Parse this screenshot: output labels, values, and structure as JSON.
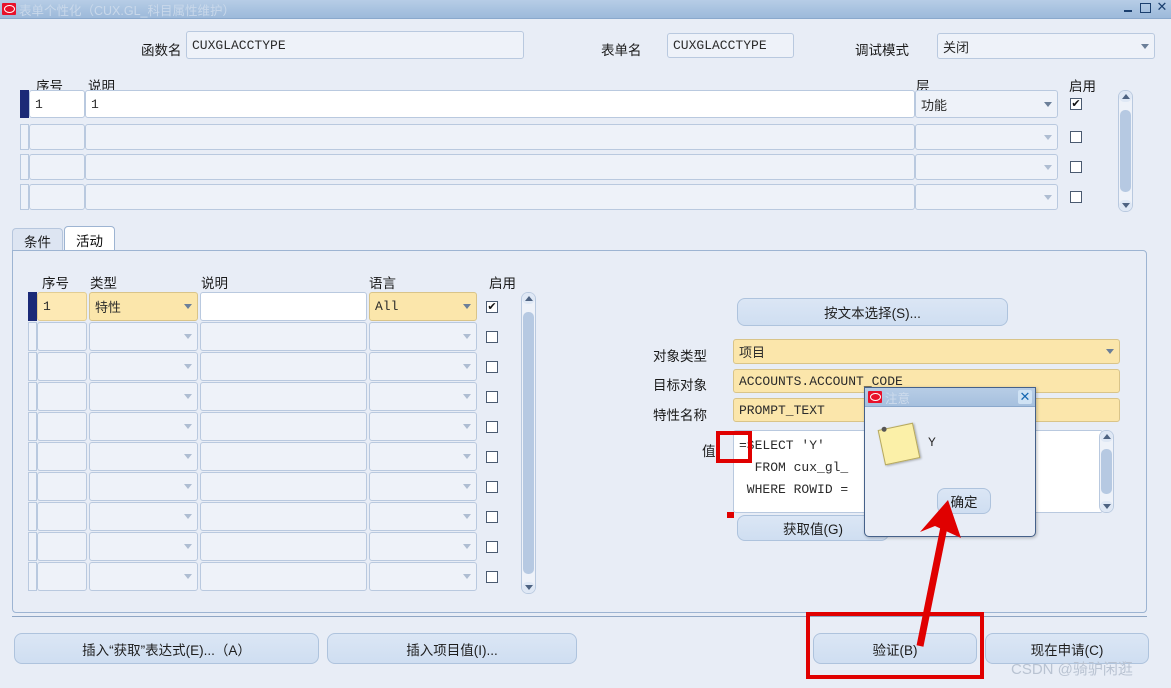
{
  "window": {
    "title": "表单个性化（CUX.GL_科目属性维护）",
    "icon": "oracle-logo-icon",
    "buttons": {
      "minimize": "–",
      "maximize": "□",
      "close": "✕"
    }
  },
  "header": {
    "function_name_label": "函数名",
    "function_name_value": "CUXGLACCTYPE",
    "form_name_label": "表单名",
    "form_name_value": "CUXGLACCTYPE",
    "debug_mode_label": "调试模式",
    "debug_mode_value": "关闭"
  },
  "rules_table": {
    "columns": [
      "序号",
      "说明",
      "层",
      "启用"
    ],
    "rows": [
      {
        "seq": "1",
        "desc": "1",
        "level": "功能",
        "enabled": true,
        "selected": true
      },
      {
        "seq": "",
        "desc": "",
        "level": "",
        "enabled": false,
        "selected": false
      },
      {
        "seq": "",
        "desc": "",
        "level": "",
        "enabled": false,
        "selected": false
      },
      {
        "seq": "",
        "desc": "",
        "level": "",
        "enabled": false,
        "selected": false
      }
    ]
  },
  "tabs": [
    {
      "label": "条件",
      "active": false
    },
    {
      "label": "活动",
      "active": true
    }
  ],
  "actions_table": {
    "columns": [
      "序号",
      "类型",
      "说明",
      "语言",
      "启用"
    ],
    "rows": [
      {
        "seq": "1",
        "type": "特性",
        "desc": "",
        "lang": "All",
        "enabled": true,
        "selected": true
      },
      {
        "seq": "",
        "type": "",
        "desc": "",
        "lang": "",
        "enabled": false,
        "selected": false
      },
      {
        "seq": "",
        "type": "",
        "desc": "",
        "lang": "",
        "enabled": false,
        "selected": false
      },
      {
        "seq": "",
        "type": "",
        "desc": "",
        "lang": "",
        "enabled": false,
        "selected": false
      },
      {
        "seq": "",
        "type": "",
        "desc": "",
        "lang": "",
        "enabled": false,
        "selected": false
      },
      {
        "seq": "",
        "type": "",
        "desc": "",
        "lang": "",
        "enabled": false,
        "selected": false
      },
      {
        "seq": "",
        "type": "",
        "desc": "",
        "lang": "",
        "enabled": false,
        "selected": false
      },
      {
        "seq": "",
        "type": "",
        "desc": "",
        "lang": "",
        "enabled": false,
        "selected": false
      },
      {
        "seq": "",
        "type": "",
        "desc": "",
        "lang": "",
        "enabled": false,
        "selected": false
      },
      {
        "seq": "",
        "type": "",
        "desc": "",
        "lang": "",
        "enabled": false,
        "selected": false
      }
    ]
  },
  "property_panel": {
    "select_by_text_button": "按文本选择(S)...",
    "object_type_label": "对象类型",
    "object_type_value": "项目",
    "target_object_label": "目标对象",
    "target_object_value": "ACCOUNTS.ACCOUNT_CODE",
    "property_name_label": "特性名称",
    "property_name_value": "PROMPT_TEXT",
    "value_label": "值",
    "value_text": "=SELECT 'Y'\n  FROM cux_gl_\n WHERE ROWID =",
    "get_value_button": "获取值(G)"
  },
  "dialog": {
    "title": "注意",
    "icon": "oracle-logo-icon",
    "close_glyph": "✕",
    "message_icon": "sticky-note-icon",
    "message": "Y",
    "ok_button": "确定"
  },
  "footer": {
    "insert_get_expression_button": "插入“获取”表达式(E)...（A）",
    "insert_item_value_button": "插入项目值(I)...",
    "validate_button": "验证(B)",
    "apply_now_button": "现在申请(C)"
  },
  "annotations": {
    "watermark": "CSDN @骑驴闲逛",
    "highlight_color": "#e00000"
  },
  "colors": {
    "titlebar": "#a9c3e0",
    "background": "#e8edf6",
    "field_yellow": "#fbe6ab",
    "selection_blue": "#1b2a77",
    "annotation_red": "#e00000"
  }
}
